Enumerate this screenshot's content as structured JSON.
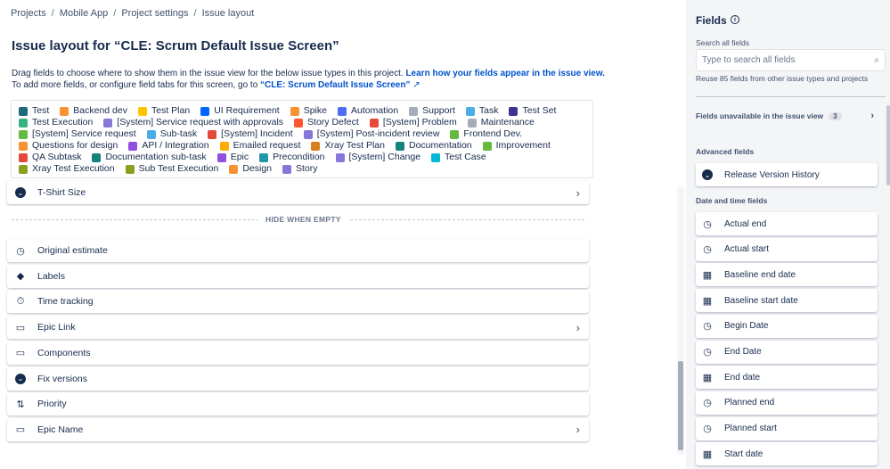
{
  "breadcrumbs": [
    "Projects",
    "Mobile App",
    "Project settings",
    "Issue layout"
  ],
  "title": "Issue layout for “CLE: Scrum Default Issue Screen”",
  "description": {
    "line1": "Drag fields to choose where to show them in the issue view for the below issue types in this project.",
    "link1": "Learn how your fields appear in the issue view.",
    "line2": "To add more fields, or configure field tabs for this screen, go to",
    "link2": "“CLE: Scrum Default Issue Screen”"
  },
  "issue_types": [
    {
      "name": "Test",
      "color": "#1d6b7a"
    },
    {
      "name": "Backend dev",
      "color": "#f79232"
    },
    {
      "name": "Test Plan",
      "color": "#ffc400"
    },
    {
      "name": "UI Requirement",
      "color": "#0065ff"
    },
    {
      "name": "Spike",
      "color": "#f79232"
    },
    {
      "name": "Automation",
      "color": "#4c6ef5"
    },
    {
      "name": "Support",
      "color": "#a5adba"
    },
    {
      "name": "Task",
      "color": "#4bade8"
    },
    {
      "name": "Test Set",
      "color": "#403294"
    },
    {
      "name": "Test Execution",
      "color": "#36b37e"
    },
    {
      "name": "[System] Service request with approvals",
      "color": "#8777d9"
    },
    {
      "name": "Story Defect",
      "color": "#ff5630"
    },
    {
      "name": "[System] Problem",
      "color": "#e5493a"
    },
    {
      "name": "Maintenance",
      "color": "#a5adba"
    },
    {
      "name": "[System] Service request",
      "color": "#65ba43"
    },
    {
      "name": "Sub-task",
      "color": "#4bade8"
    },
    {
      "name": "[System] Incident",
      "color": "#e5493a"
    },
    {
      "name": "[System] Post-incident review",
      "color": "#8777d9"
    },
    {
      "name": "Frontend Dev.",
      "color": "#63ba3c"
    },
    {
      "name": "Questions for design",
      "color": "#f79232"
    },
    {
      "name": "API / Integration",
      "color": "#904ee2"
    },
    {
      "name": "Emailed request",
      "color": "#ffab00"
    },
    {
      "name": "Xray Test Plan",
      "color": "#d97e1c"
    },
    {
      "name": "Documentation",
      "color": "#13837d"
    },
    {
      "name": "Improvement",
      "color": "#63ba3c"
    },
    {
      "name": "QA Subtask",
      "color": "#e5493a"
    },
    {
      "name": "Documentation sub-task",
      "color": "#13837d"
    },
    {
      "name": "Epic",
      "color": "#904ee2"
    },
    {
      "name": "Precondition",
      "color": "#2196a9"
    },
    {
      "name": "[System] Change",
      "color": "#8777d9"
    },
    {
      "name": "Test Case",
      "color": "#00b8d9"
    },
    {
      "name": "Xray Test Execution",
      "color": "#8aa11e"
    },
    {
      "name": "Sub Test Execution",
      "color": "#8aa11e"
    },
    {
      "name": "Design",
      "color": "#f79232"
    },
    {
      "name": "Story",
      "color": "#8777d9"
    }
  ],
  "tshirt": "T-Shirt Size",
  "hide_when_empty": "HIDE WHEN EMPTY",
  "fields": [
    {
      "label": "Original estimate",
      "icon": "clock",
      "chevron": false
    },
    {
      "label": "Labels",
      "icon": "tag",
      "chevron": false
    },
    {
      "label": "Time tracking",
      "icon": "stopwatch",
      "chevron": false
    },
    {
      "label": "Epic Link",
      "icon": "field",
      "chevron": true
    },
    {
      "label": "Components",
      "icon": "field",
      "chevron": false
    },
    {
      "label": "Fix versions",
      "icon": "dropdown",
      "chevron": false
    },
    {
      "label": "Priority",
      "icon": "sort",
      "chevron": false
    },
    {
      "label": "Epic Name",
      "icon": "field",
      "chevron": true
    }
  ],
  "sidebar": {
    "title": "Fields",
    "search_label": "Search all fields",
    "search_placeholder": "Type to search all fields",
    "hint": "Reuse 85 fields from other issue types and projects",
    "unavailable": "Fields unavailable in the issue view",
    "unavailable_count": "3",
    "advanced_title": "Advanced fields",
    "advanced": [
      "Release Version History"
    ],
    "date_title": "Date and time fields",
    "dates": [
      {
        "label": "Actual end",
        "icon": "clock"
      },
      {
        "label": "Actual start",
        "icon": "clock"
      },
      {
        "label": "Baseline end date",
        "icon": "calendar"
      },
      {
        "label": "Baseline start date",
        "icon": "calendar"
      },
      {
        "label": "Begin Date",
        "icon": "clock"
      },
      {
        "label": "End Date",
        "icon": "clock"
      },
      {
        "label": "End date",
        "icon": "calendar"
      },
      {
        "label": "Planned end",
        "icon": "clock"
      },
      {
        "label": "Planned start",
        "icon": "clock"
      },
      {
        "label": "Start date",
        "icon": "calendar"
      }
    ]
  }
}
